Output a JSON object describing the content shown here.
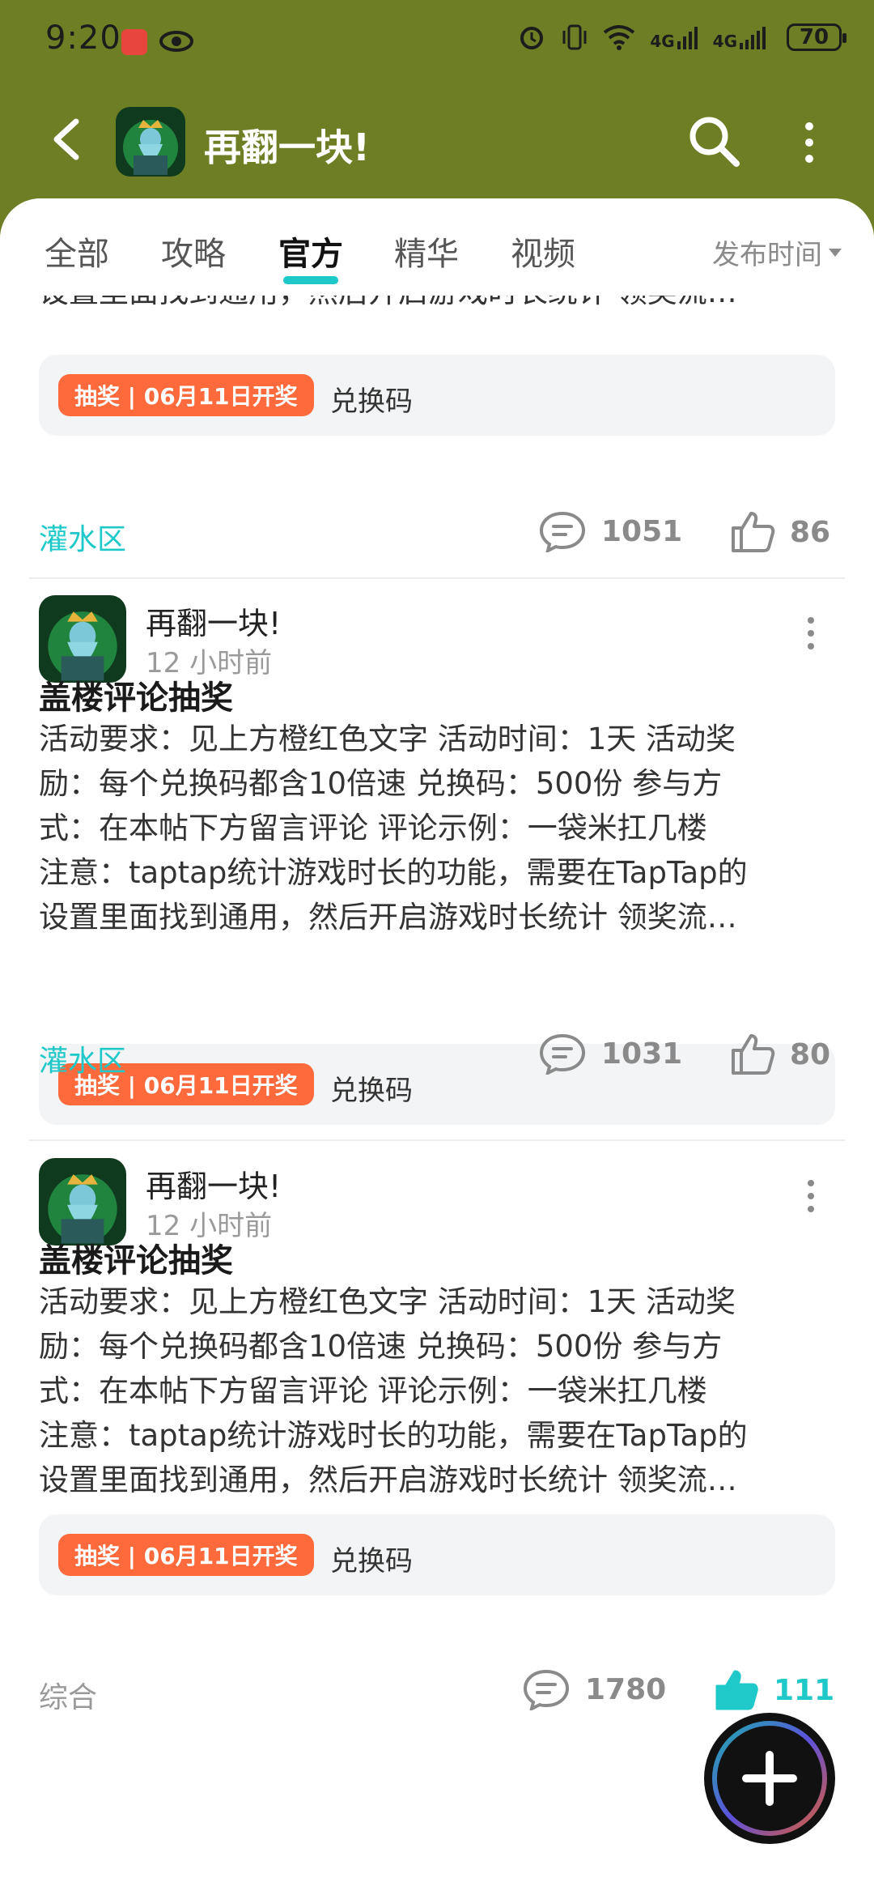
{
  "status_bar": {
    "time": "9:20",
    "battery": "70",
    "net1": "4G",
    "net2": "4G"
  },
  "header": {
    "title": "再翻一块!"
  },
  "tabs": [
    {
      "label": "全部"
    },
    {
      "label": "攻略"
    },
    {
      "label": "官方"
    },
    {
      "label": "精华"
    },
    {
      "label": "视频"
    }
  ],
  "active_tab": "官方",
  "sort_label": "发布时间",
  "posts": [
    {
      "body_last_line": "设置里面找到通用，然后开启游戏时长统计 领奖流…",
      "tag": "抽奖 | 06月11日开奖",
      "tag_text": "兑换码",
      "category": "灌水区",
      "comments": "1051",
      "likes": "86"
    },
    {
      "author": "再翻一块!",
      "time": "12 小时前",
      "title": "盖楼评论抽奖",
      "body_lines": [
        "活动要求：见上方橙红色文字 活动时间：1天 活动奖",
        "励：每个兑换码都含10倍速 兑换码：500份 参与方",
        "式：在本帖下方留言评论 评论示例：一袋米扛几楼",
        "注意：taptap统计游戏时长的功能，需要在TapTap的",
        "设置里面找到通用，然后开启游戏时长统计 领奖流…"
      ],
      "tag": "抽奖 | 06月11日开奖",
      "tag_text": "兑换码",
      "category": "灌水区",
      "comments": "1031",
      "likes": "80"
    },
    {
      "author": "再翻一块!",
      "time": "12 小时前",
      "title": "盖楼评论抽奖",
      "body_lines": [
        "活动要求：见上方橙红色文字 活动时间：1天 活动奖",
        "励：每个兑换码都含10倍速 兑换码：500份 参与方",
        "式：在本帖下方留言评论 评论示例：一袋米扛几楼",
        "注意：taptap统计游戏时长的功能，需要在TapTap的",
        "设置里面找到通用，然后开启游戏时长统计 领奖流…"
      ],
      "tag": "抽奖 | 06月11日开奖",
      "tag_text": "兑换码",
      "category": "综合",
      "comments": "1780",
      "likes": "111"
    }
  ],
  "colors": {
    "header_bg": "#6d7e24",
    "accent": "#1fc9c9",
    "tag": "#ff6a3d"
  },
  "icons": [
    "back-arrow-icon",
    "search-icon",
    "more-vertical-icon",
    "comment-icon",
    "thumbs-up-icon",
    "plus-icon"
  ]
}
